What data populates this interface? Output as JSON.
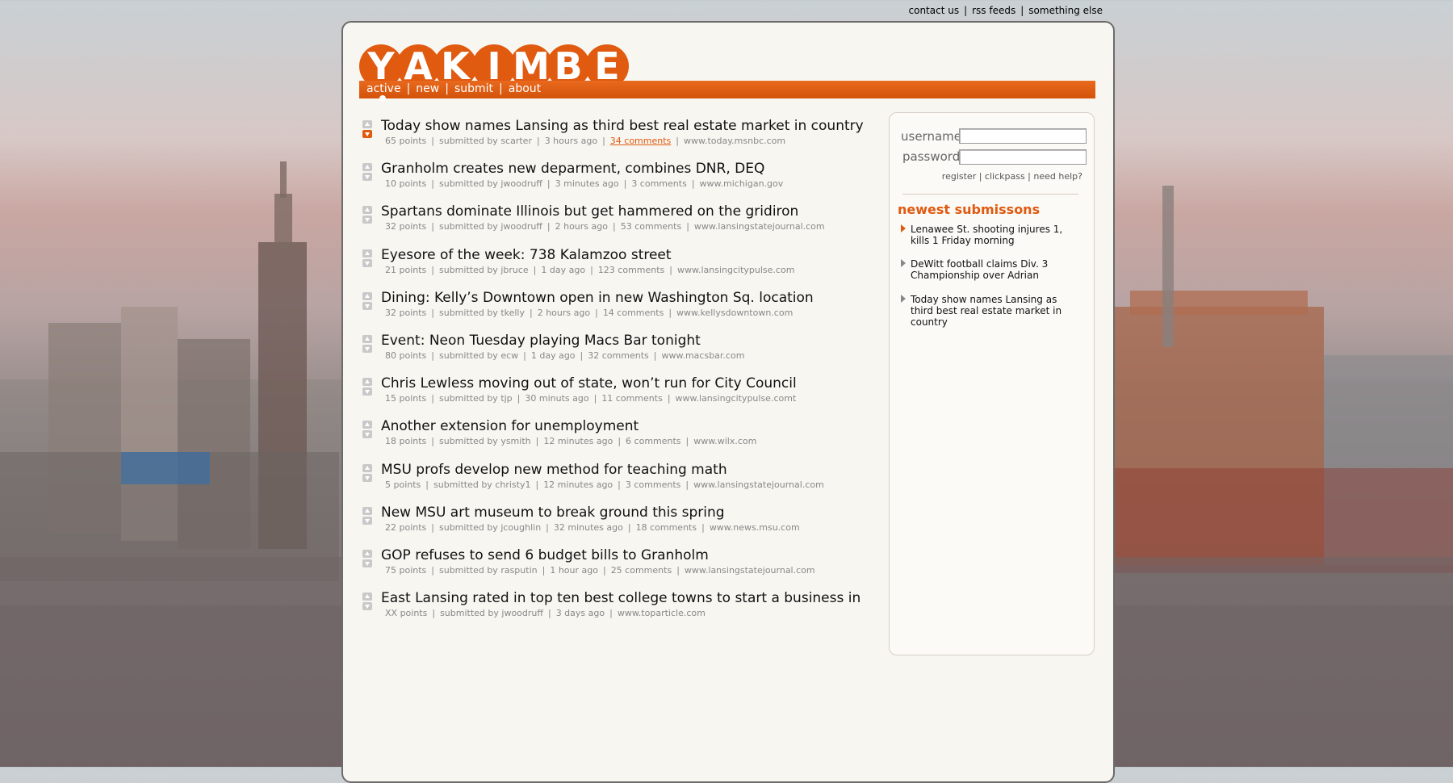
{
  "top_links": [
    "contact us",
    "rss feeds",
    "something else"
  ],
  "logo": {
    "letters": [
      "Y",
      "A",
      "K",
      "I",
      "M",
      "B",
      "E"
    ]
  },
  "nav": [
    "active",
    "new",
    "submit",
    "about"
  ],
  "stories": [
    {
      "title": "Today show names Lansing as third best real estate market in country",
      "points": "65 points",
      "user": "submitted by scarter",
      "time": "3 hours ago",
      "comments": "34 comments",
      "domain": "www.today.msnbc.com",
      "voted": true
    },
    {
      "title": "Granholm creates new deparment, combines DNR, DEQ",
      "points": "10 points",
      "user": "submitted by jwoodruff",
      "time": "3 minutes ago",
      "comments": "3 comments",
      "domain": "www.michigan.gov",
      "voted": false
    },
    {
      "title": "Spartans dominate Illinois but get hammered on the gridiron",
      "points": "32 points",
      "user": "submitted by jwoodruff",
      "time": "2 hours ago",
      "comments": "53 comments",
      "domain": "www.lansingstatejournal.com",
      "voted": false
    },
    {
      "title": "Eyesore of the week: 738 Kalamzoo street",
      "points": "21 points",
      "user": "submitted by jbruce",
      "time": "1 day ago",
      "comments": "123 comments",
      "domain": "www.lansingcitypulse.com",
      "voted": false
    },
    {
      "title": "Dining: Kelly’s Downtown open in new Washington Sq. location",
      "points": "32 points",
      "user": "submitted by tkelly",
      "time": "2 hours ago",
      "comments": "14 comments",
      "domain": "www.kellysdowntown.com",
      "voted": false
    },
    {
      "title": "Event: Neon Tuesday playing Macs Bar tonight",
      "points": "80 points",
      "user": "submitted by ecw",
      "time": "1 day ago",
      "comments": "32 comments",
      "domain": "www.macsbar.com",
      "voted": false
    },
    {
      "title": "Chris Lewless moving out of state, won’t run for City Council",
      "points": "15 points",
      "user": "submitted by tjp",
      "time": "30 minuts ago",
      "comments": "11 comments",
      "domain": "www.lansingcitypulse.comt",
      "voted": false
    },
    {
      "title": "Another extension for unemployment",
      "points": "18 points",
      "user": "submitted by ysmith",
      "time": "12 minutes ago",
      "comments": "6 comments",
      "domain": "www.wilx.com",
      "voted": false
    },
    {
      "title": "MSU profs develop new method for teaching math",
      "points": "5 points",
      "user": "submitted by christy1",
      "time": "12 minutes ago",
      "comments": "3 comments",
      "domain": "www.lansingstatejournal.com",
      "voted": false
    },
    {
      "title": "New MSU art museum to break ground this spring",
      "points": "22 points",
      "user": "submitted by jcoughlin",
      "time": "32 minutes ago",
      "comments": "18 comments",
      "domain": "www.news.msu.com",
      "voted": false
    },
    {
      "title": "GOP refuses to send 6 budget bills to Granholm",
      "points": "75 points",
      "user": "submitted by rasputin",
      "time": "1 hour ago",
      "comments": "25 comments",
      "domain": "www.lansingstatejournal.com",
      "voted": false
    },
    {
      "title": "East Lansing rated in top ten best college towns to start a business in",
      "points": "XX points",
      "user": "submitted by jwoodruff",
      "time": "3 days ago",
      "comments": "",
      "domain": "www.toparticle.com",
      "voted": false
    }
  ],
  "login": {
    "username_label": "username",
    "password_label": "password",
    "links": [
      "register",
      "clickpass",
      "need help?"
    ]
  },
  "newest": {
    "title": "newest submissons",
    "items": [
      "Lenawee St. shooting injures 1, kills 1 Friday morning",
      "DeWitt football claims Div. 3 Championship over Adrian",
      "Today show names Lansing as third best real estate market in country"
    ]
  },
  "colors": {
    "accent": "#e05a10",
    "panel": "#f8f6f1"
  }
}
